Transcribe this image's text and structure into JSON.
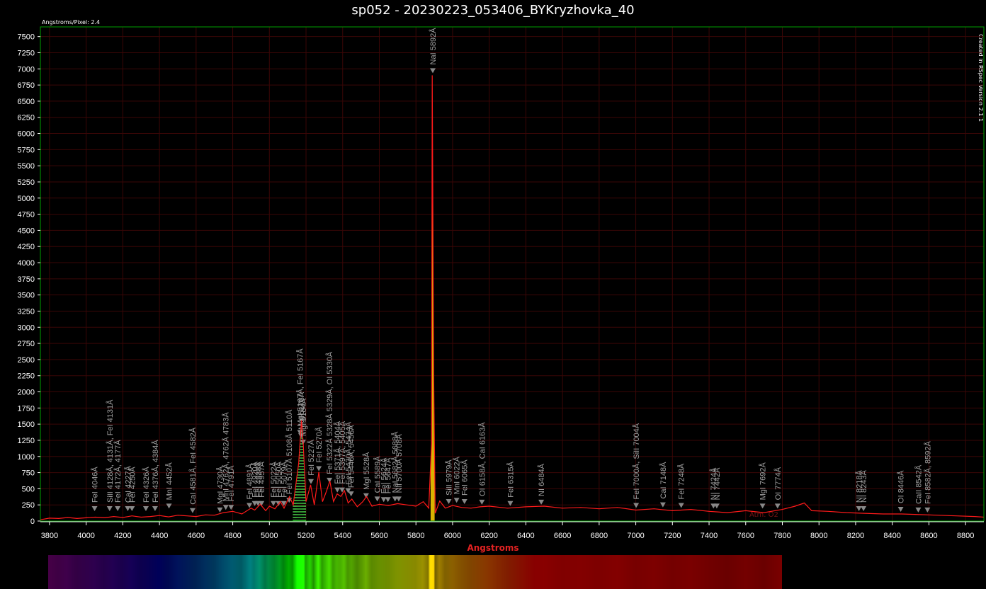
{
  "chart_data": {
    "type": "line",
    "title": "sp052 - 20230223_053406_BYKryzhovka_40",
    "subtitle_left": "Angstroms/Pixel: 2.4",
    "watermark": "Created in RSpec Version 2.1.1",
    "xlabel": "Angstroms",
    "ylabel": "",
    "xlim": [
      3750,
      8900
    ],
    "ylim": [
      0,
      7650
    ],
    "x_ticks": [
      3800,
      4000,
      4200,
      4400,
      4600,
      4800,
      5000,
      5200,
      5400,
      5600,
      5800,
      6000,
      6200,
      6400,
      6600,
      6800,
      7000,
      7200,
      7400,
      7600,
      7800,
      8000,
      8200,
      8400,
      8600,
      8800
    ],
    "y_ticks": [
      0,
      250,
      500,
      750,
      1000,
      1250,
      1500,
      1750,
      2000,
      2250,
      2500,
      2750,
      3000,
      3250,
      3500,
      3750,
      4000,
      4250,
      4500,
      4750,
      5000,
      5250,
      5500,
      5750,
      6000,
      6250,
      6500,
      6750,
      7000,
      7250,
      7500
    ],
    "grid": true,
    "series": [
      {
        "color": "#ff1a1a",
        "points": [
          [
            3750,
            20
          ],
          [
            3800,
            45
          ],
          [
            3850,
            40
          ],
          [
            3900,
            55
          ],
          [
            3950,
            40
          ],
          [
            4000,
            50
          ],
          [
            4050,
            60
          ],
          [
            4100,
            50
          ],
          [
            4150,
            70
          ],
          [
            4200,
            55
          ],
          [
            4250,
            80
          ],
          [
            4300,
            60
          ],
          [
            4350,
            70
          ],
          [
            4400,
            85
          ],
          [
            4450,
            65
          ],
          [
            4500,
            90
          ],
          [
            4550,
            80
          ],
          [
            4600,
            70
          ],
          [
            4650,
            95
          ],
          [
            4700,
            90
          ],
          [
            4750,
            130
          ],
          [
            4800,
            150
          ],
          [
            4850,
            110
          ],
          [
            4900,
            200
          ],
          [
            4920,
            170
          ],
          [
            4950,
            260
          ],
          [
            4980,
            160
          ],
          [
            5000,
            230
          ],
          [
            5030,
            190
          ],
          [
            5060,
            300
          ],
          [
            5080,
            200
          ],
          [
            5110,
            380
          ],
          [
            5130,
            250
          ],
          [
            5160,
            900
          ],
          [
            5175,
            1560
          ],
          [
            5185,
            1200
          ],
          [
            5200,
            300
          ],
          [
            5225,
            560
          ],
          [
            5245,
            250
          ],
          [
            5270,
            760
          ],
          [
            5290,
            300
          ],
          [
            5310,
            450
          ],
          [
            5330,
            620
          ],
          [
            5350,
            300
          ],
          [
            5370,
            420
          ],
          [
            5390,
            380
          ],
          [
            5410,
            470
          ],
          [
            5430,
            280
          ],
          [
            5450,
            340
          ],
          [
            5480,
            220
          ],
          [
            5510,
            300
          ],
          [
            5530,
            380
          ],
          [
            5560,
            230
          ],
          [
            5600,
            260
          ],
          [
            5650,
            240
          ],
          [
            5700,
            270
          ],
          [
            5750,
            250
          ],
          [
            5800,
            230
          ],
          [
            5840,
            300
          ],
          [
            5870,
            200
          ],
          [
            5885,
            1200
          ],
          [
            5889,
            6900
          ],
          [
            5893,
            4400
          ],
          [
            5897,
            2200
          ],
          [
            5905,
            120
          ],
          [
            5930,
            310
          ],
          [
            5960,
            200
          ],
          [
            6000,
            240
          ],
          [
            6050,
            210
          ],
          [
            6100,
            200
          ],
          [
            6150,
            220
          ],
          [
            6200,
            230
          ],
          [
            6300,
            200
          ],
          [
            6400,
            220
          ],
          [
            6500,
            230
          ],
          [
            6600,
            200
          ],
          [
            6700,
            210
          ],
          [
            6800,
            190
          ],
          [
            6900,
            210
          ],
          [
            7000,
            170
          ],
          [
            7100,
            190
          ],
          [
            7200,
            160
          ],
          [
            7300,
            180
          ],
          [
            7400,
            150
          ],
          [
            7500,
            130
          ],
          [
            7600,
            160
          ],
          [
            7700,
            130
          ],
          [
            7800,
            180
          ],
          [
            7870,
            230
          ],
          [
            7920,
            280
          ],
          [
            7960,
            160
          ],
          [
            8050,
            150
          ],
          [
            8150,
            130
          ],
          [
            8250,
            120
          ],
          [
            8350,
            110
          ],
          [
            8450,
            110
          ],
          [
            8550,
            100
          ],
          [
            8650,
            90
          ],
          [
            8750,
            80
          ],
          [
            8850,
            70
          ],
          [
            8900,
            60
          ]
        ]
      }
    ],
    "annotations": [
      {
        "x": 4046,
        "y": 120,
        "label": "FeI 4046Å"
      },
      {
        "x": 4128,
        "y": 120,
        "label": "SiII 4128Å, 4131Å, FeI 4131Å"
      },
      {
        "x": 4172,
        "y": 120,
        "label": "FeI 4172Å, 4177Å"
      },
      {
        "x": 4227,
        "y": 120,
        "label": "CaI 4227Å"
      },
      {
        "x": 4250,
        "y": 120,
        "label": "FeI 4250Å"
      },
      {
        "x": 4326,
        "y": 120,
        "label": "FeI 4326Å"
      },
      {
        "x": 4376,
        "y": 120,
        "label": "FeI 4376Å, 4384Å"
      },
      {
        "x": 4452,
        "y": 160,
        "label": "MnI 4452Å"
      },
      {
        "x": 4581,
        "y": 90,
        "label": "CaI 4581Å, FeI 4582Å"
      },
      {
        "x": 4730,
        "y": 100,
        "label": "MgI 4730Å"
      },
      {
        "x": 4762,
        "y": 140,
        "label": "MnI 4762Å, 4762Å 4783Å"
      },
      {
        "x": 4791,
        "y": 140,
        "label": "FeI 4791Å"
      },
      {
        "x": 4891,
        "y": 170,
        "label": "FeI 4891Å"
      },
      {
        "x": 4920,
        "y": 200,
        "label": "FeI 4920Å"
      },
      {
        "x": 4938,
        "y": 200,
        "label": "FeI 4938Å"
      },
      {
        "x": 4957,
        "y": 200,
        "label": "FeI 4957Å"
      },
      {
        "x": 5022,
        "y": 200,
        "label": "FeI 5022Å"
      },
      {
        "x": 5050,
        "y": 200,
        "label": "FeI 5050Å"
      },
      {
        "x": 5079,
        "y": 200,
        "label": "FeI 5079Å"
      },
      {
        "x": 5108,
        "y": 250,
        "label": "FeI 5107Å 5108Å 5110Å"
      },
      {
        "x": 5167,
        "y": 1300,
        "label": "MgI 5167Å, FeI 5167Å"
      },
      {
        "x": 5173,
        "y": 1250,
        "label": "MgI 5173Å"
      },
      {
        "x": 5184,
        "y": 1150,
        "label": "MgI 5184Å"
      },
      {
        "x": 5227,
        "y": 540,
        "label": "FeI 5227Å"
      },
      {
        "x": 5270,
        "y": 740,
        "label": "FeI 5270Å"
      },
      {
        "x": 5328,
        "y": 560,
        "label": "FeI 5322Å 5328Å 5329Å, OI 5330Å"
      },
      {
        "x": 5371,
        "y": 410,
        "label": "FeI 5371Å, 5404Å"
      },
      {
        "x": 5397,
        "y": 410,
        "label": "FeI 5397Å, 5405Å"
      },
      {
        "x": 5430,
        "y": 400,
        "label": "FeI 5430Å, 5434Å"
      },
      {
        "x": 5446,
        "y": 350,
        "label": "FeI 5446Å, 5456Å"
      },
      {
        "x": 5528,
        "y": 320,
        "label": "MgI 5528Å"
      },
      {
        "x": 5589,
        "y": 270,
        "label": "CaI 5589Å"
      },
      {
        "x": 5624,
        "y": 260,
        "label": "FeI 5624Å"
      },
      {
        "x": 5647,
        "y": 260,
        "label": "FeI 5647Å"
      },
      {
        "x": 5686,
        "y": 270,
        "label": "NaI 5682Å 5688Å"
      },
      {
        "x": 5706,
        "y": 270,
        "label": "NiI 5700Å 5708Å"
      },
      {
        "x": 5892,
        "y": 6900,
        "label": "NaI 5892Å"
      },
      {
        "x": 5979,
        "y": 230,
        "label": "SiII 5979Å"
      },
      {
        "x": 6022,
        "y": 250,
        "label": "MnI 6022Å"
      },
      {
        "x": 6065,
        "y": 230,
        "label": "FeI 6065Å"
      },
      {
        "x": 6160,
        "y": 220,
        "label": "OI 6158Å, CaI 6163Å"
      },
      {
        "x": 6315,
        "y": 200,
        "label": "FeI 6315Å"
      },
      {
        "x": 6484,
        "y": 220,
        "label": "NI 6484Å"
      },
      {
        "x": 7002,
        "y": 170,
        "label": "FeI 7000Å, SiII 7004Å"
      },
      {
        "x": 7148,
        "y": 180,
        "label": "CaI 7148Å"
      },
      {
        "x": 7248,
        "y": 170,
        "label": "FeI 7248Å"
      },
      {
        "x": 7424,
        "y": 160,
        "label": "NI 7424Å"
      },
      {
        "x": 7442,
        "y": 160,
        "label": "NI 7442Å"
      },
      {
        "x": 7692,
        "y": 160,
        "label": "MgI 7692Å"
      },
      {
        "x": 7774,
        "y": 160,
        "label": "OI 7774Å"
      },
      {
        "x": 8218,
        "y": 120,
        "label": "NI 8218Å"
      },
      {
        "x": 8243,
        "y": 120,
        "label": "NI 8243Å"
      },
      {
        "x": 8446,
        "y": 110,
        "label": "OI 8446Å"
      },
      {
        "x": 8542,
        "y": 100,
        "label": "CaII 8542Å"
      },
      {
        "x": 8592,
        "y": 100,
        "label": "FeI 8582Å, 8592Å"
      }
    ],
    "atm_label": {
      "x": 7620,
      "y": 20,
      "label": "Atm. O2"
    }
  },
  "colors": {
    "background": "#000000",
    "grid": "#3a0606",
    "frame": "#00a000",
    "series": "#ff1a1a",
    "fill_yellow": "#ffd200",
    "fill_green": "#3aa83a",
    "label": "#a0a0a0",
    "xlabel": "#e32222"
  },
  "spectrum_strip": {
    "x_start": 3800,
    "x_end": 7800
  }
}
